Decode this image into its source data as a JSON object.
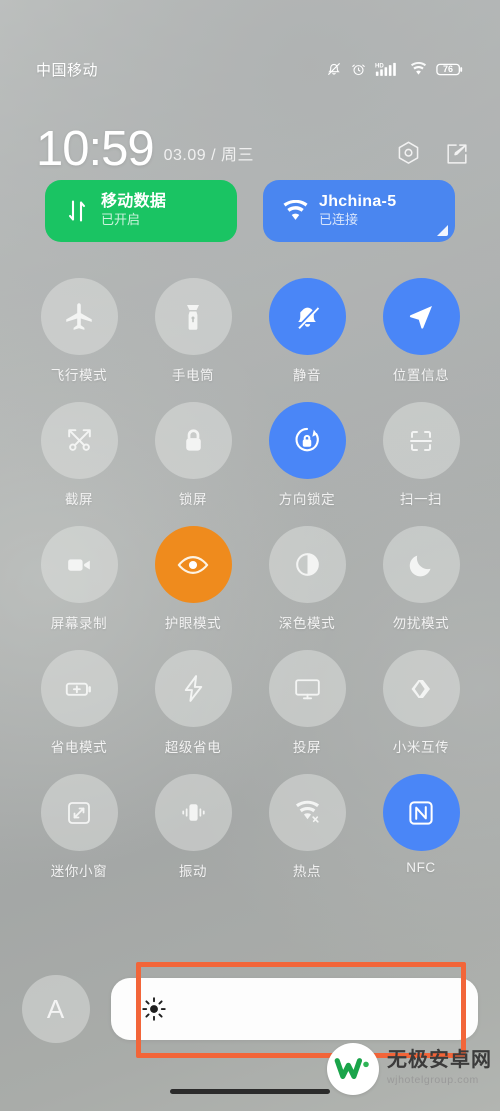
{
  "status_bar": {
    "carrier": "中国移动",
    "battery_level": "76",
    "icons": [
      "mute-icon",
      "alarm-icon",
      "hd-signal-icon",
      "wifi-icon",
      "battery-icon"
    ]
  },
  "clock": {
    "time": "10:59",
    "date": "03.09 / 周三",
    "settings_icon": "settings-hexagon-icon",
    "edit_icon": "edit-pencil-icon"
  },
  "cards": [
    {
      "title": "移动数据",
      "subtitle": "已开启",
      "icon": "data-transfer-icon",
      "color": "#1ac463",
      "state": "on"
    },
    {
      "title": "Jhchina-5",
      "subtitle": "已连接",
      "icon": "wifi-icon",
      "color": "#4a86f0",
      "state": "connected"
    }
  ],
  "toggles": [
    {
      "label": "飞行模式",
      "icon": "airplane-icon",
      "state": "off"
    },
    {
      "label": "手电筒",
      "icon": "flashlight-icon",
      "state": "off"
    },
    {
      "label": "静音",
      "icon": "bell-muted-icon",
      "state": "on",
      "color": "#4a86f7"
    },
    {
      "label": "位置信息",
      "icon": "location-arrow-icon",
      "state": "on",
      "color": "#4a86f7"
    },
    {
      "label": "截屏",
      "icon": "screenshot-scissors-icon",
      "state": "off"
    },
    {
      "label": "锁屏",
      "icon": "lock-icon",
      "state": "off"
    },
    {
      "label": "方向锁定",
      "icon": "rotation-lock-icon",
      "state": "on",
      "color": "#4a86f7"
    },
    {
      "label": "扫一扫",
      "icon": "scan-frame-icon",
      "state": "off"
    },
    {
      "label": "屏幕录制",
      "icon": "camcorder-icon",
      "state": "off"
    },
    {
      "label": "护眼模式",
      "icon": "eye-icon",
      "state": "on",
      "color": "#ef8b1d"
    },
    {
      "label": "深色模式",
      "icon": "contrast-circle-icon",
      "state": "off"
    },
    {
      "label": "勿扰模式",
      "icon": "moon-icon",
      "state": "off"
    },
    {
      "label": "省电模式",
      "icon": "battery-plus-icon",
      "state": "off"
    },
    {
      "label": "超级省电",
      "icon": "lightning-bolt-icon",
      "state": "off"
    },
    {
      "label": "投屏",
      "icon": "monitor-cast-icon",
      "state": "off"
    },
    {
      "label": "小米互传",
      "icon": "mi-share-icon",
      "state": "off"
    },
    {
      "label": "迷你小窗",
      "icon": "mini-window-icon",
      "state": "off"
    },
    {
      "label": "振动",
      "icon": "vibrate-icon",
      "state": "off"
    },
    {
      "label": "热点",
      "icon": "hotspot-icon",
      "state": "off"
    },
    {
      "label": "NFC",
      "icon": "nfc-icon",
      "state": "on",
      "color": "#4a86f7"
    }
  ],
  "brightness": {
    "auto_label": "A",
    "slider_icon": "sun-brightness-icon",
    "fill_percent": 100
  },
  "annotation": {
    "color": "#f26539",
    "target": "brightness-slider"
  },
  "watermark": {
    "name": "无极安卓网",
    "url": "wjhotelgroup.com",
    "logo": "w-logo-icon"
  }
}
